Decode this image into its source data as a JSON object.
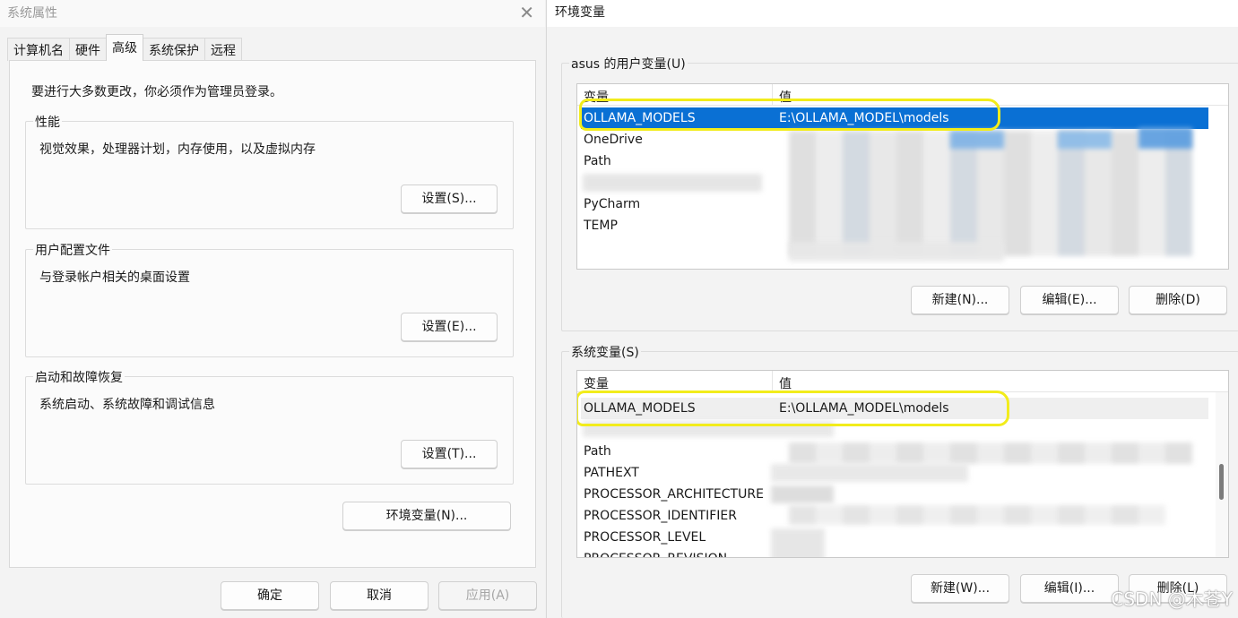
{
  "system_properties": {
    "title": "系统属性",
    "tabs": [
      {
        "label": "计算机名",
        "active": false
      },
      {
        "label": "硬件",
        "active": false
      },
      {
        "label": "高级",
        "active": true
      },
      {
        "label": "系统保护",
        "active": false
      },
      {
        "label": "远程",
        "active": false
      }
    ],
    "notice": "要进行大多数更改，你必须作为管理员登录。",
    "groups": [
      {
        "legend": "性能",
        "description": "视觉效果，处理器计划，内存使用，以及虚拟内存",
        "button": "设置(S)..."
      },
      {
        "legend": "用户配置文件",
        "description": "与登录帐户相关的桌面设置",
        "button": "设置(E)..."
      },
      {
        "legend": "启动和故障恢复",
        "description": "系统启动、系统故障和调试信息",
        "button": "设置(T)..."
      }
    ],
    "env_button": "环境变量(N)...",
    "footer": {
      "ok": "确定",
      "cancel": "取消",
      "apply": "应用(A)"
    }
  },
  "environment_variables": {
    "title": "环境变量",
    "user": {
      "legend": "asus 的用户变量(U)",
      "col_name": "变量",
      "col_value": "值",
      "rows": [
        {
          "name": "OLLAMA_MODELS",
          "value": "E:\\OLLAMA_MODEL\\models",
          "selected": true
        },
        {
          "name": "OneDrive",
          "value": ""
        },
        {
          "name": "Path",
          "value": ""
        },
        {
          "name": "",
          "value": ""
        },
        {
          "name": "PyCharm",
          "value": ""
        },
        {
          "name": "TEMP",
          "value": ""
        }
      ],
      "buttons": {
        "new": "新建(N)...",
        "edit": "编辑(E)...",
        "delete": "删除(D)"
      }
    },
    "system": {
      "legend": "系统变量(S)",
      "col_name": "变量",
      "col_value": "值",
      "rows": [
        {
          "name": "OLLAMA_MODELS",
          "value": "E:\\OLLAMA_MODEL\\models",
          "hover": true
        },
        {
          "name": "",
          "value": ""
        },
        {
          "name": "Path",
          "value": ""
        },
        {
          "name": "PATHEXT",
          "value": ""
        },
        {
          "name": "PROCESSOR_ARCHITECTURE",
          "value": ""
        },
        {
          "name": "PROCESSOR_IDENTIFIER",
          "value": ""
        },
        {
          "name": "PROCESSOR_LEVEL",
          "value": ""
        },
        {
          "name": "PROCESSOR_REVISION",
          "value": ""
        }
      ],
      "buttons": {
        "new": "新建(W)...",
        "edit": "编辑(I)...",
        "delete": "删除(L)"
      }
    }
  },
  "watermark": "CSDN @木苍Y",
  "colors": {
    "selection": "#0a70d4",
    "highlight_circle": "#f2ec1b"
  }
}
